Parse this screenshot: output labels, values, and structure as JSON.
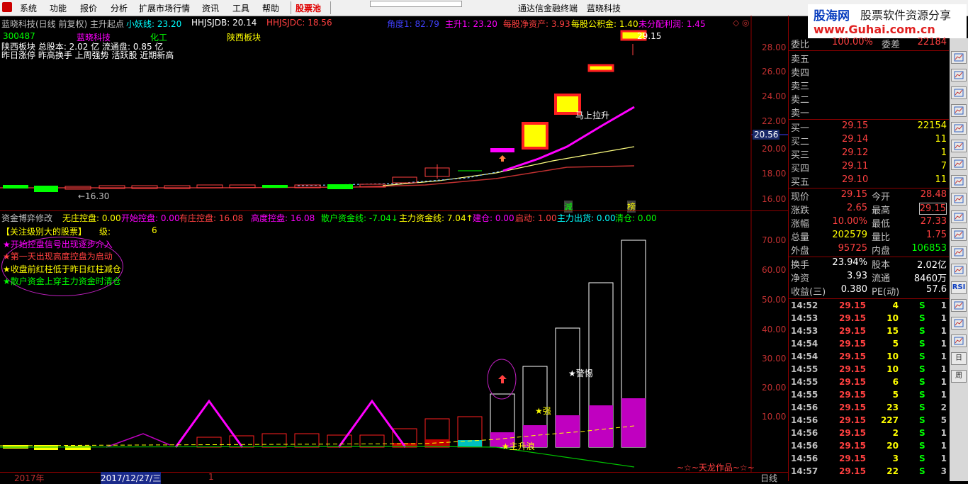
{
  "menubar": {
    "items": [
      "系统",
      "功能",
      "报价",
      "分析",
      "扩展市场行情",
      "资讯",
      "工具",
      "帮助"
    ],
    "stock_pool": "股票池",
    "app_title": "通达信金融终端",
    "stock_title": "蓝晓科技"
  },
  "logo": {
    "name": "股海网",
    "slogan": "股票软件资源分享",
    "url": "www.Guhai.com.cn"
  },
  "main_chart": {
    "header": "蓝晓科技(日线 前复权) 主升起点",
    "indicators": [
      {
        "label": "小妖线: 23.20",
        "color": "#00ffff"
      },
      {
        "label": "HHJSJDB: 20.14",
        "color": "#ffffff"
      },
      {
        "label": "HHJSJDC: 18.56",
        "color": "#ff4040"
      },
      {
        "label": "角度1: 82.79",
        "color": "#4040ff"
      },
      {
        "label": "主升1: 23.20",
        "color": "#ff00ff"
      },
      {
        "label": "每股净资产: 3.93",
        "color": "#ff4040"
      },
      {
        "label": "每股公积金: 1.40",
        "color": "#ffff00"
      },
      {
        "label": "未分配利润: 1.45",
        "color": "#ff00ff"
      }
    ],
    "code": "300487",
    "name": "蓝晓科技",
    "industry": "化工",
    "region": "陕西板块",
    "info1": "陕西板块  总股本: 2.02 亿   流通盘: 0.85 亿",
    "info2": "昨日涨停 昨高换手 上周强势 活跃股 近期新高",
    "price_axis": [
      "28.00",
      "26.00",
      "24.00",
      "22.00",
      "20.00",
      "18.00",
      "16.00"
    ],
    "current_price_tag": "20.56",
    "high_label": "29.15",
    "low_label": "←16.30",
    "annotation": "马上拉升",
    "jian": "減",
    "bang": "榜"
  },
  "sub_chart": {
    "title": "资金博弈修改",
    "values": [
      {
        "label": "无庄控盘: 0.00",
        "color": "#ffff00"
      },
      {
        "label": "开始控盘: 0.00",
        "color": "#ff00ff"
      },
      {
        "label": "有庄控盘: 16.08",
        "color": "#ff4040"
      },
      {
        "label": "高度控盘: 16.08",
        "color": "#ff00ff"
      },
      {
        "label": "散户资金线: -7.04↓",
        "color": "#00ff00"
      },
      {
        "label": "主力资金线: 7.04↑",
        "color": "#ffff00"
      },
      {
        "label": "建仓: 0.00",
        "color": "#ff00ff"
      },
      {
        "label": "启动: 1.00",
        "color": "#ff4040"
      },
      {
        "label": "主力出货: 0.00",
        "color": "#00ffff"
      },
      {
        "label": "清仓: 0.00",
        "color": "#00ff00"
      }
    ],
    "focus_title": "【关注级别大的股票】",
    "focus_level_label": "级:",
    "focus_level_value": "6",
    "legend": [
      {
        "text": "★开始控盘信号出现逐步介入",
        "color": "#ff00ff"
      },
      {
        "text": "★第一天出现高度控盘为启动",
        "color": "#ff4040"
      },
      {
        "text": "★收盘前红柱低于昨日红柱减仓",
        "color": "#ffff00"
      },
      {
        "text": "★散户资金上穿主力资金时清仓",
        "color": "#00ff00"
      }
    ],
    "y_axis": [
      "70.00",
      "60.00",
      "50.00",
      "40.00",
      "30.00",
      "20.00",
      "10.00"
    ],
    "notes": {
      "warn": "★警惕",
      "strong": "★强",
      "main_wave": "★主升浪"
    },
    "footer": "~☆~天龙作品~☆~"
  },
  "bottom": {
    "year": "2017年",
    "date": "2017/12/27/三",
    "mark": "1",
    "period": "日线"
  },
  "quote": {
    "weibi_label": "委比",
    "weibi_value": "100.00%",
    "weicha_label": "委差",
    "weicha_value": "22184",
    "sell": [
      {
        "label": "卖五"
      },
      {
        "label": "卖四"
      },
      {
        "label": "卖三"
      },
      {
        "label": "卖二"
      },
      {
        "label": "卖一"
      }
    ],
    "buy": [
      {
        "label": "买一",
        "price": "29.15",
        "vol": "22154"
      },
      {
        "label": "买二",
        "price": "29.14",
        "vol": "11"
      },
      {
        "label": "买三",
        "price": "29.12",
        "vol": "1"
      },
      {
        "label": "买四",
        "price": "29.11",
        "vol": "7"
      },
      {
        "label": "买五",
        "price": "29.10",
        "vol": "11"
      }
    ],
    "stats": [
      {
        "l1": "现价",
        "v1": "29.15",
        "c1": "#ff4040",
        "l2": "今开",
        "v2": "28.48",
        "c2": "#ff4040"
      },
      {
        "l1": "涨跌",
        "v1": "2.65",
        "c1": "#ff4040",
        "l2": "最高",
        "v2": "29.15",
        "c2": "#ff4040"
      },
      {
        "l1": "涨幅",
        "v1": "10.00%",
        "c1": "#ff4040",
        "l2": "最低",
        "v2": "27.33",
        "c2": "#ff4040"
      },
      {
        "l1": "总量",
        "v1": "202579",
        "c1": "#ffff00",
        "l2": "量比",
        "v2": "1.75",
        "c2": "#ff4040"
      },
      {
        "l1": "外盘",
        "v1": "95725",
        "c1": "#ff4040",
        "l2": "内盘",
        "v2": "106853",
        "c2": "#00ff00"
      }
    ],
    "fund": [
      {
        "l1": "换手",
        "v1": "23.94%",
        "l2": "股本",
        "v2": "2.02亿"
      },
      {
        "l1": "净资",
        "v1": "3.93",
        "l2": "流通",
        "v2": "8460万"
      },
      {
        "l1": "收益(三)",
        "v1": "0.380",
        "l2": "PE(动)",
        "v2": "57.6"
      }
    ],
    "ticks": [
      {
        "t": "14:52",
        "p": "29.15",
        "v": "4",
        "s": "S",
        "n": "1"
      },
      {
        "t": "14:53",
        "p": "29.15",
        "v": "10",
        "s": "S",
        "n": "1"
      },
      {
        "t": "14:53",
        "p": "29.15",
        "v": "15",
        "s": "S",
        "n": "1"
      },
      {
        "t": "14:54",
        "p": "29.15",
        "v": "5",
        "s": "S",
        "n": "1"
      },
      {
        "t": "14:54",
        "p": "29.15",
        "v": "10",
        "s": "S",
        "n": "1"
      },
      {
        "t": "14:55",
        "p": "29.15",
        "v": "10",
        "s": "S",
        "n": "1"
      },
      {
        "t": "14:55",
        "p": "29.15",
        "v": "6",
        "s": "S",
        "n": "1"
      },
      {
        "t": "14:55",
        "p": "29.15",
        "v": "5",
        "s": "S",
        "n": "1"
      },
      {
        "t": "14:56",
        "p": "29.15",
        "v": "23",
        "s": "S",
        "n": "2"
      },
      {
        "t": "14:56",
        "p": "29.15",
        "v": "227",
        "s": "S",
        "n": "5"
      },
      {
        "t": "14:56",
        "p": "29.15",
        "v": "2",
        "s": "S",
        "n": "1"
      },
      {
        "t": "14:56",
        "p": "29.15",
        "v": "20",
        "s": "S",
        "n": "1"
      },
      {
        "t": "14:56",
        "p": "29.15",
        "v": "3",
        "s": "S",
        "n": "1"
      },
      {
        "t": "14:57",
        "p": "29.15",
        "v": "22",
        "s": "S",
        "n": "3"
      }
    ]
  },
  "toolbar_icons": [
    "chart-icon",
    "list-icon",
    "grid-icon",
    "news-icon",
    "kline-icon",
    "trend-icon",
    "flag-icon",
    "f10-icon",
    "calc-icon",
    "pie-icon",
    "table-icon",
    "bar-icon",
    "map-icon",
    "rsi-icon",
    "window-icon",
    "move-icon",
    "pen-icon",
    "day-icon",
    "week-icon"
  ],
  "toolbar_labels": {
    "rsi": "RSI",
    "day": "日",
    "week": "周"
  }
}
